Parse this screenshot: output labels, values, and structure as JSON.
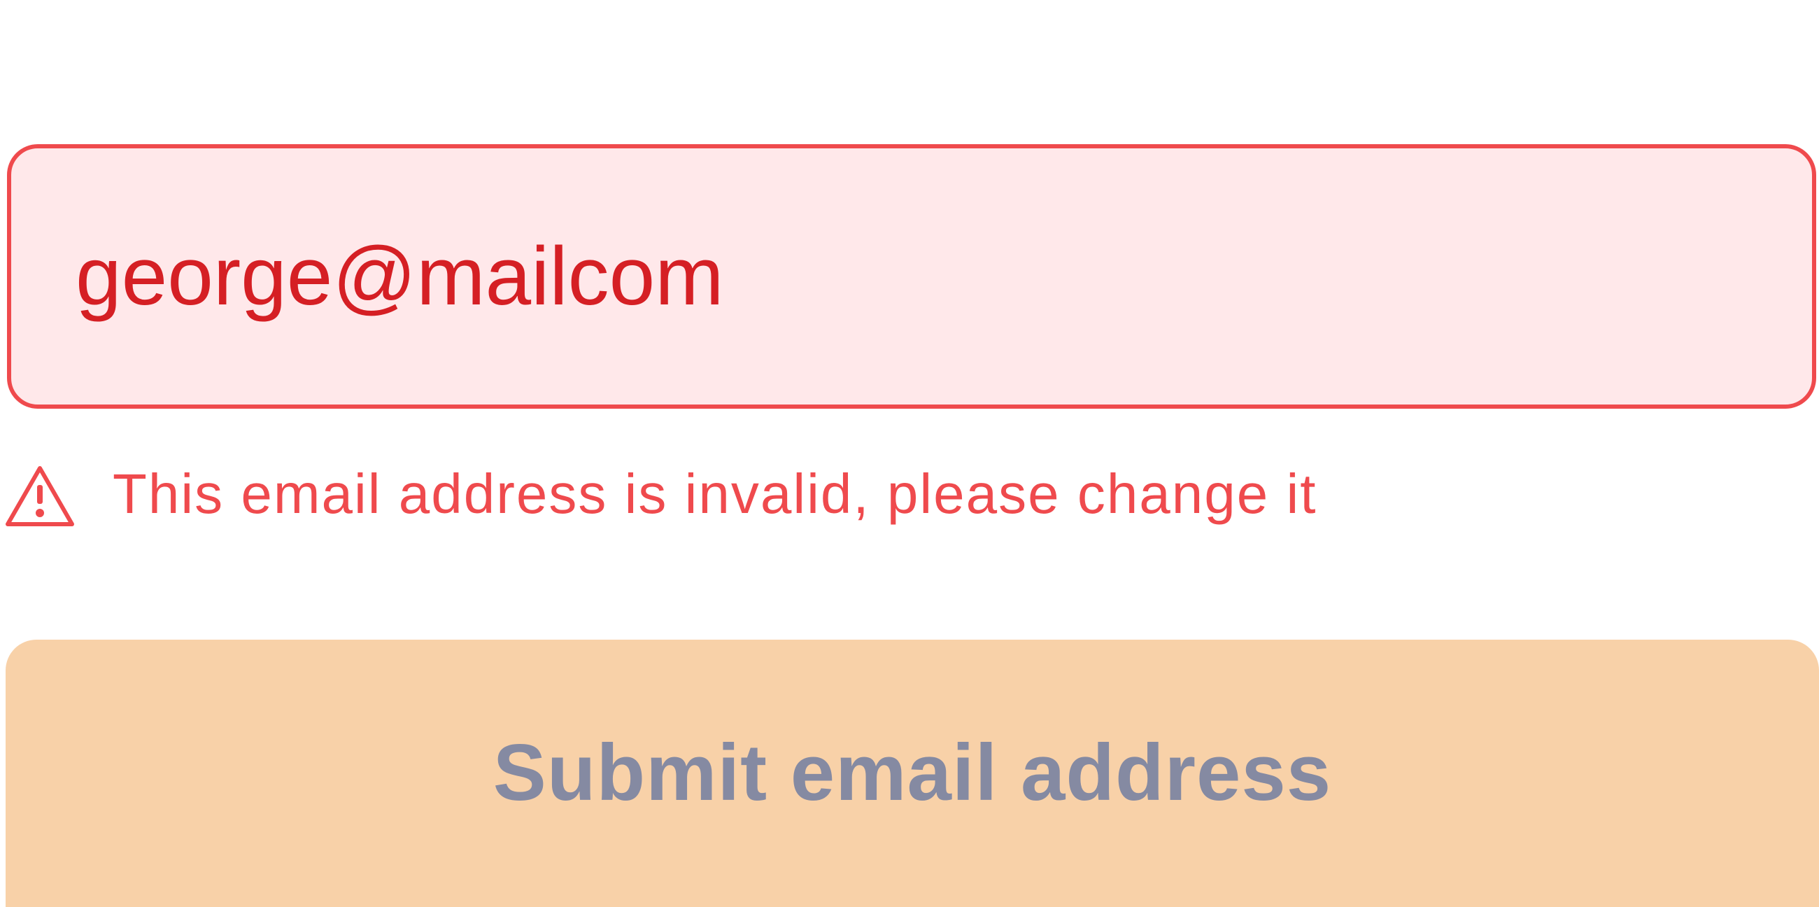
{
  "form": {
    "email_value": "george@mailcom",
    "error": {
      "message": "This email address is invalid, please change it",
      "icon": "warning-triangle-icon"
    },
    "submit_label": "Submit email address"
  },
  "colors": {
    "error_red": "#ef4a4d",
    "input_text_red": "#d51f24",
    "input_background": "#ffe8ea",
    "button_background": "#f8d1a8",
    "button_text": "#858aa2"
  }
}
